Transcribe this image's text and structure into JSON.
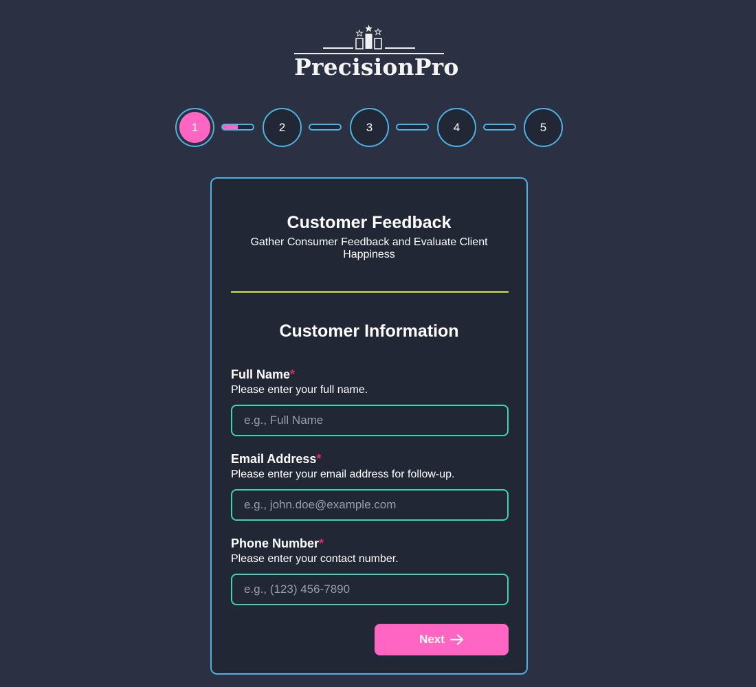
{
  "brand": {
    "name": "PrecisionPro",
    "logo_icon": "podium-stars-icon"
  },
  "stepper": {
    "steps": [
      {
        "label": "1",
        "state": "active"
      },
      {
        "label": "2",
        "state": "pending"
      },
      {
        "label": "3",
        "state": "pending"
      },
      {
        "label": "4",
        "state": "pending"
      },
      {
        "label": "5",
        "state": "pending"
      }
    ],
    "connector_progress": [
      0.5,
      0,
      0,
      0
    ]
  },
  "card": {
    "title": "Customer Feedback",
    "subtitle": "Gather Consumer Feedback and Evaluate Client Happiness",
    "section_title": "Customer Information"
  },
  "fields": [
    {
      "label": "Full Name",
      "required_mark": "*",
      "help": "Please enter your full name.",
      "placeholder": "e.g., Full Name",
      "value": ""
    },
    {
      "label": "Email Address",
      "required_mark": "*",
      "help": "Please enter your email address for follow-up.",
      "placeholder": "e.g., john.doe@example.com",
      "value": ""
    },
    {
      "label": "Phone Number",
      "required_mark": "*",
      "help": "Please enter your contact number.",
      "placeholder": "e.g., (123) 456-7890",
      "value": ""
    }
  ],
  "actions": {
    "next_label": "Next",
    "next_icon": "arrow-right-icon"
  },
  "colors": {
    "background": "#2b3142",
    "card": "#212735",
    "accent_pink": "#ff66c4",
    "accent_blue": "#4cb3e3",
    "input_border": "#3dd6b0",
    "divider": "#d4e43c",
    "required": "#e0286e"
  }
}
